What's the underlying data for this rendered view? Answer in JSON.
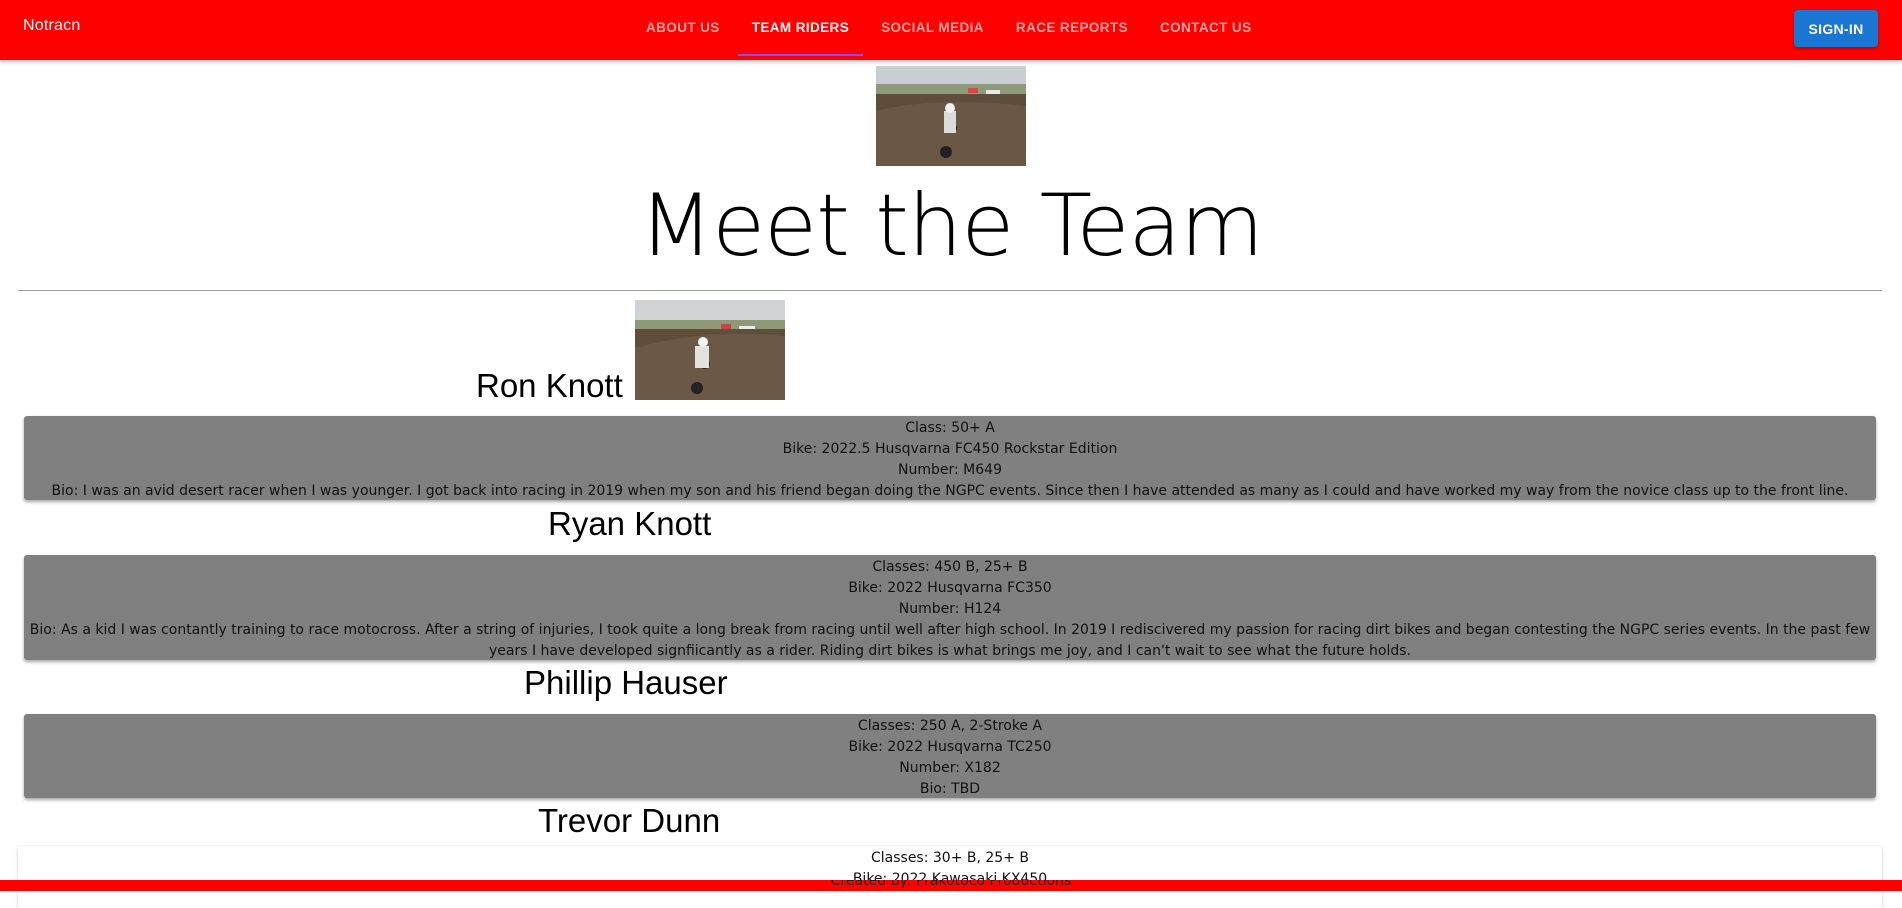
{
  "header": {
    "brand": "Notracn",
    "nav": [
      "ABOUT US",
      "TEAM RIDERS",
      "SOCIAL MEDIA",
      "RACE REPORTS",
      "CONTACT US"
    ],
    "active_nav": "TEAM RIDERS",
    "signin_label": "SIGN-IN"
  },
  "main": {
    "title": "Meet the Team",
    "riders": [
      {
        "name": "Ron Knott",
        "class": "Class: 50+ A",
        "bike": "Bike: 2022.5 Husqvarna FC450 Rockstar Edition",
        "number": "Number: M649",
        "bio": "Bio: I was an avid desert racer when I was younger. I got back into racing in 2019 when my son and his friend began doing the NGPC events. Since then I have attended as many as I could and have worked my way from the novice class up to the front line."
      },
      {
        "name": "Ryan Knott",
        "class": "Classes: 450 B, 25+ B",
        "bike": "Bike: 2022 Husqvarna FC350",
        "number": "Number: H124",
        "bio": "Bio: As a kid I was contantly training to race motocross. After a string of injuries, I took quite a long break from racing until well after high school. In 2019 I rediscivered my passion for racing dirt bikes and began contesting the NGPC series events. In the past few years I have developed signfiicantly as a rider. Riding dirt bikes is what brings me joy, and I can't wait to see what the future holds."
      },
      {
        "name": "Phillip Hauser",
        "class": "Classes: 250 A, 2-Stroke A",
        "bike": "Bike: 2022 Husqvarna TC250",
        "number": "Number: X182",
        "bio": "Bio: TBD"
      },
      {
        "name": "Trevor Dunn",
        "class": "Classes: 30+ B, 25+ B",
        "bike": "Bike: 2022 Kawasaki KX450"
      }
    ]
  },
  "footer": {
    "text": "Created by: Prakotoco Productions"
  },
  "colors": {
    "appbar": "#ff0000",
    "signin": "#1976d2",
    "card": "#808080",
    "active_indicator": "#8a4cff"
  }
}
